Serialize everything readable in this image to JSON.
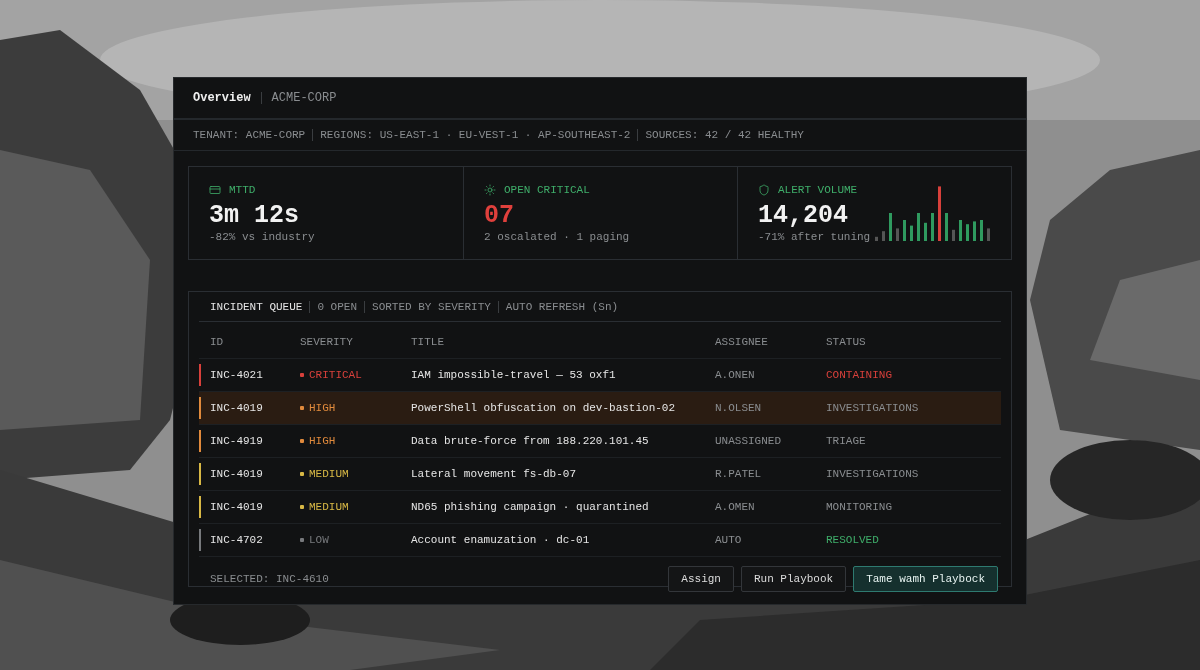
{
  "header": {
    "title": "Overview",
    "tenant": "ACME-CORP"
  },
  "meta": [
    "TENANT: ACME-CORP",
    "REGIONS: US-EAST-1 · EU-VEST-1 · AP-SOUTHEAST-2",
    "SOURCES: 42 / 42 HEALTHY"
  ],
  "stats": [
    {
      "kind": "card",
      "label": "MTTD",
      "value": "3m 12s",
      "alert": false,
      "note": "-82% vs industry"
    },
    {
      "kind": "sun",
      "label": "OPEN CRITICAL",
      "value": "07",
      "alert": true,
      "note": "2 oscalated · 1 paging"
    },
    {
      "kind": "shield",
      "label": "ALERT VOLUME",
      "value": "14,204",
      "alert": false,
      "note": "-71% after tuning",
      "sparkline": true
    }
  ],
  "queue": {
    "title": "INCIDENT QUEUE",
    "meta": [
      "0 OPEN",
      "SORTED BY SEVERITY",
      "AUTO REFRESH (Sn)"
    ],
    "columns": [
      "ID",
      "SEVERITY",
      "TITLE",
      "ASSIGNEE",
      "STATUS"
    ],
    "rows": [
      {
        "id": "INC-4021",
        "severity": "CRITICAL",
        "color": "#d8403b",
        "title": "IAM impossible-travel — 53 oxf1",
        "assignee": "A.ONEN",
        "status": {
          "text": "CONTAINING",
          "color": "#d8403b"
        },
        "selected": false
      },
      {
        "id": "INC-4019",
        "severity": "HIGH",
        "color": "#e08a3c",
        "title": "PowerShell obfuscation on dev-bastion-02",
        "assignee": "N.OLSEN",
        "status": {
          "text": "INVESTIGATIONS",
          "color": "#8a8d90"
        },
        "selected": true
      },
      {
        "id": "INC-4919",
        "severity": "HIGH",
        "color": "#e08a3c",
        "title": "Data brute-force from 188.220.101.45",
        "assignee": "UNASSIGNED",
        "status": {
          "text": "TRIAGE",
          "color": "#8a8d90"
        },
        "selected": false
      },
      {
        "id": "INC-4019",
        "severity": "MEDIUM",
        "color": "#d8b845",
        "title": "Lateral movement fs-db-07",
        "assignee": "R.PATEL",
        "status": {
          "text": "INVESTIGATIONS",
          "color": "#8a8d90"
        },
        "selected": false
      },
      {
        "id": "INC-4019",
        "severity": "MEDIUM",
        "color": "#d8b845",
        "title": "ND65 phishing campaign · quarantined",
        "assignee": "A.OMEN",
        "status": {
          "text": "MONITORING",
          "color": "#8a8d90"
        },
        "selected": false
      },
      {
        "id": "INC-4702",
        "severity": "LOW",
        "color": "#77797c",
        "title": "Account enamuzation · dc-01",
        "assignee": "AUTO",
        "status": {
          "text": "RESOLVED",
          "color": "#3fae6a"
        },
        "selected": false
      }
    ],
    "selected_label": "SELECTED: INC-4610",
    "buttons": [
      {
        "label": "Assign",
        "primary": false
      },
      {
        "label": "Run Playbook",
        "primary": false
      },
      {
        "label": "Tame wamh Playbock",
        "primary": true
      }
    ]
  }
}
